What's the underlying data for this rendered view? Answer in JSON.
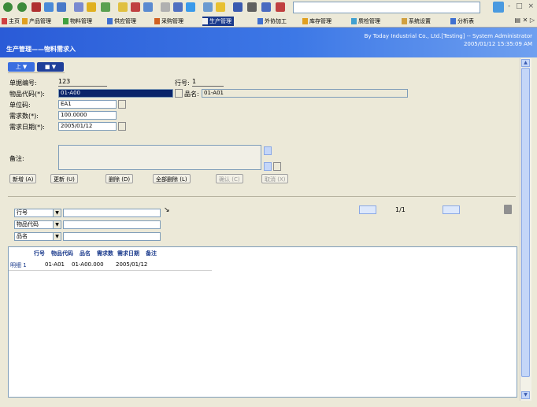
{
  "colors": {
    "title_bar": "#2a5bd7",
    "active_tab": "#1a3a8c",
    "nav_up": "#3a6ee0",
    "nav_down": "#1f3f9a"
  },
  "module_tabs": [
    {
      "label": "主页"
    },
    {
      "label": "产品管理"
    },
    {
      "label": "物料管理"
    },
    {
      "label": "供应管理"
    },
    {
      "label": "采购管理"
    },
    {
      "label": "生产管理"
    },
    {
      "label": "外协加工"
    },
    {
      "label": "库存管理"
    },
    {
      "label": "质检管理"
    },
    {
      "label": "系统设置"
    },
    {
      "label": "分析表"
    }
  ],
  "window_controls": [
    "-",
    "□",
    "×"
  ],
  "title_bar": {
    "page_title": "生产管理——物料需求入",
    "company_line1": "By Today Industrial Co., Ltd.[Testing] -- System Administrator",
    "company_line2": "2005/01/12 15:35:09 AM"
  },
  "nav": {
    "up_label": "上 ▼",
    "down_label": "■ ▼"
  },
  "form": {
    "order_no_label": "单据编号:",
    "order_no_value": "123",
    "line_no_label": "行号:",
    "line_no_value": "1",
    "item_code_label": "物品代码(*):",
    "item_code_value": "01-A00",
    "item_name_label": "品名:",
    "item_name_value": "01-A01",
    "unit_label": "单位码:",
    "unit_value": "EA1",
    "qty_label": "需求数(*):",
    "qty_value": "100.0000",
    "date_label": "需求日期(*):",
    "date_value": "2005/01/12",
    "remark_label": "备注:",
    "remark_value": ""
  },
  "actions": [
    {
      "label": "新增 (A)",
      "enabled": true
    },
    {
      "label": "更新 (U)",
      "enabled": true
    },
    {
      "label": "删除 (D)",
      "enabled": true
    },
    {
      "label": "全部删除 (L)",
      "enabled": true
    },
    {
      "label": "确认 (C)",
      "enabled": false
    },
    {
      "label": "取消 (X)",
      "enabled": false
    }
  ],
  "search": {
    "combos": [
      "行号",
      "物品代码",
      "品名"
    ],
    "page_text": "1/1"
  },
  "grid": {
    "columns": [
      "行号",
      "物品代码",
      "品名",
      "需求数",
      "需求日期",
      "备注"
    ],
    "rows": [
      [
        "明细 1",
        "01-A01",
        "01-A00.000",
        "",
        "2005/01/12",
        ""
      ]
    ]
  }
}
